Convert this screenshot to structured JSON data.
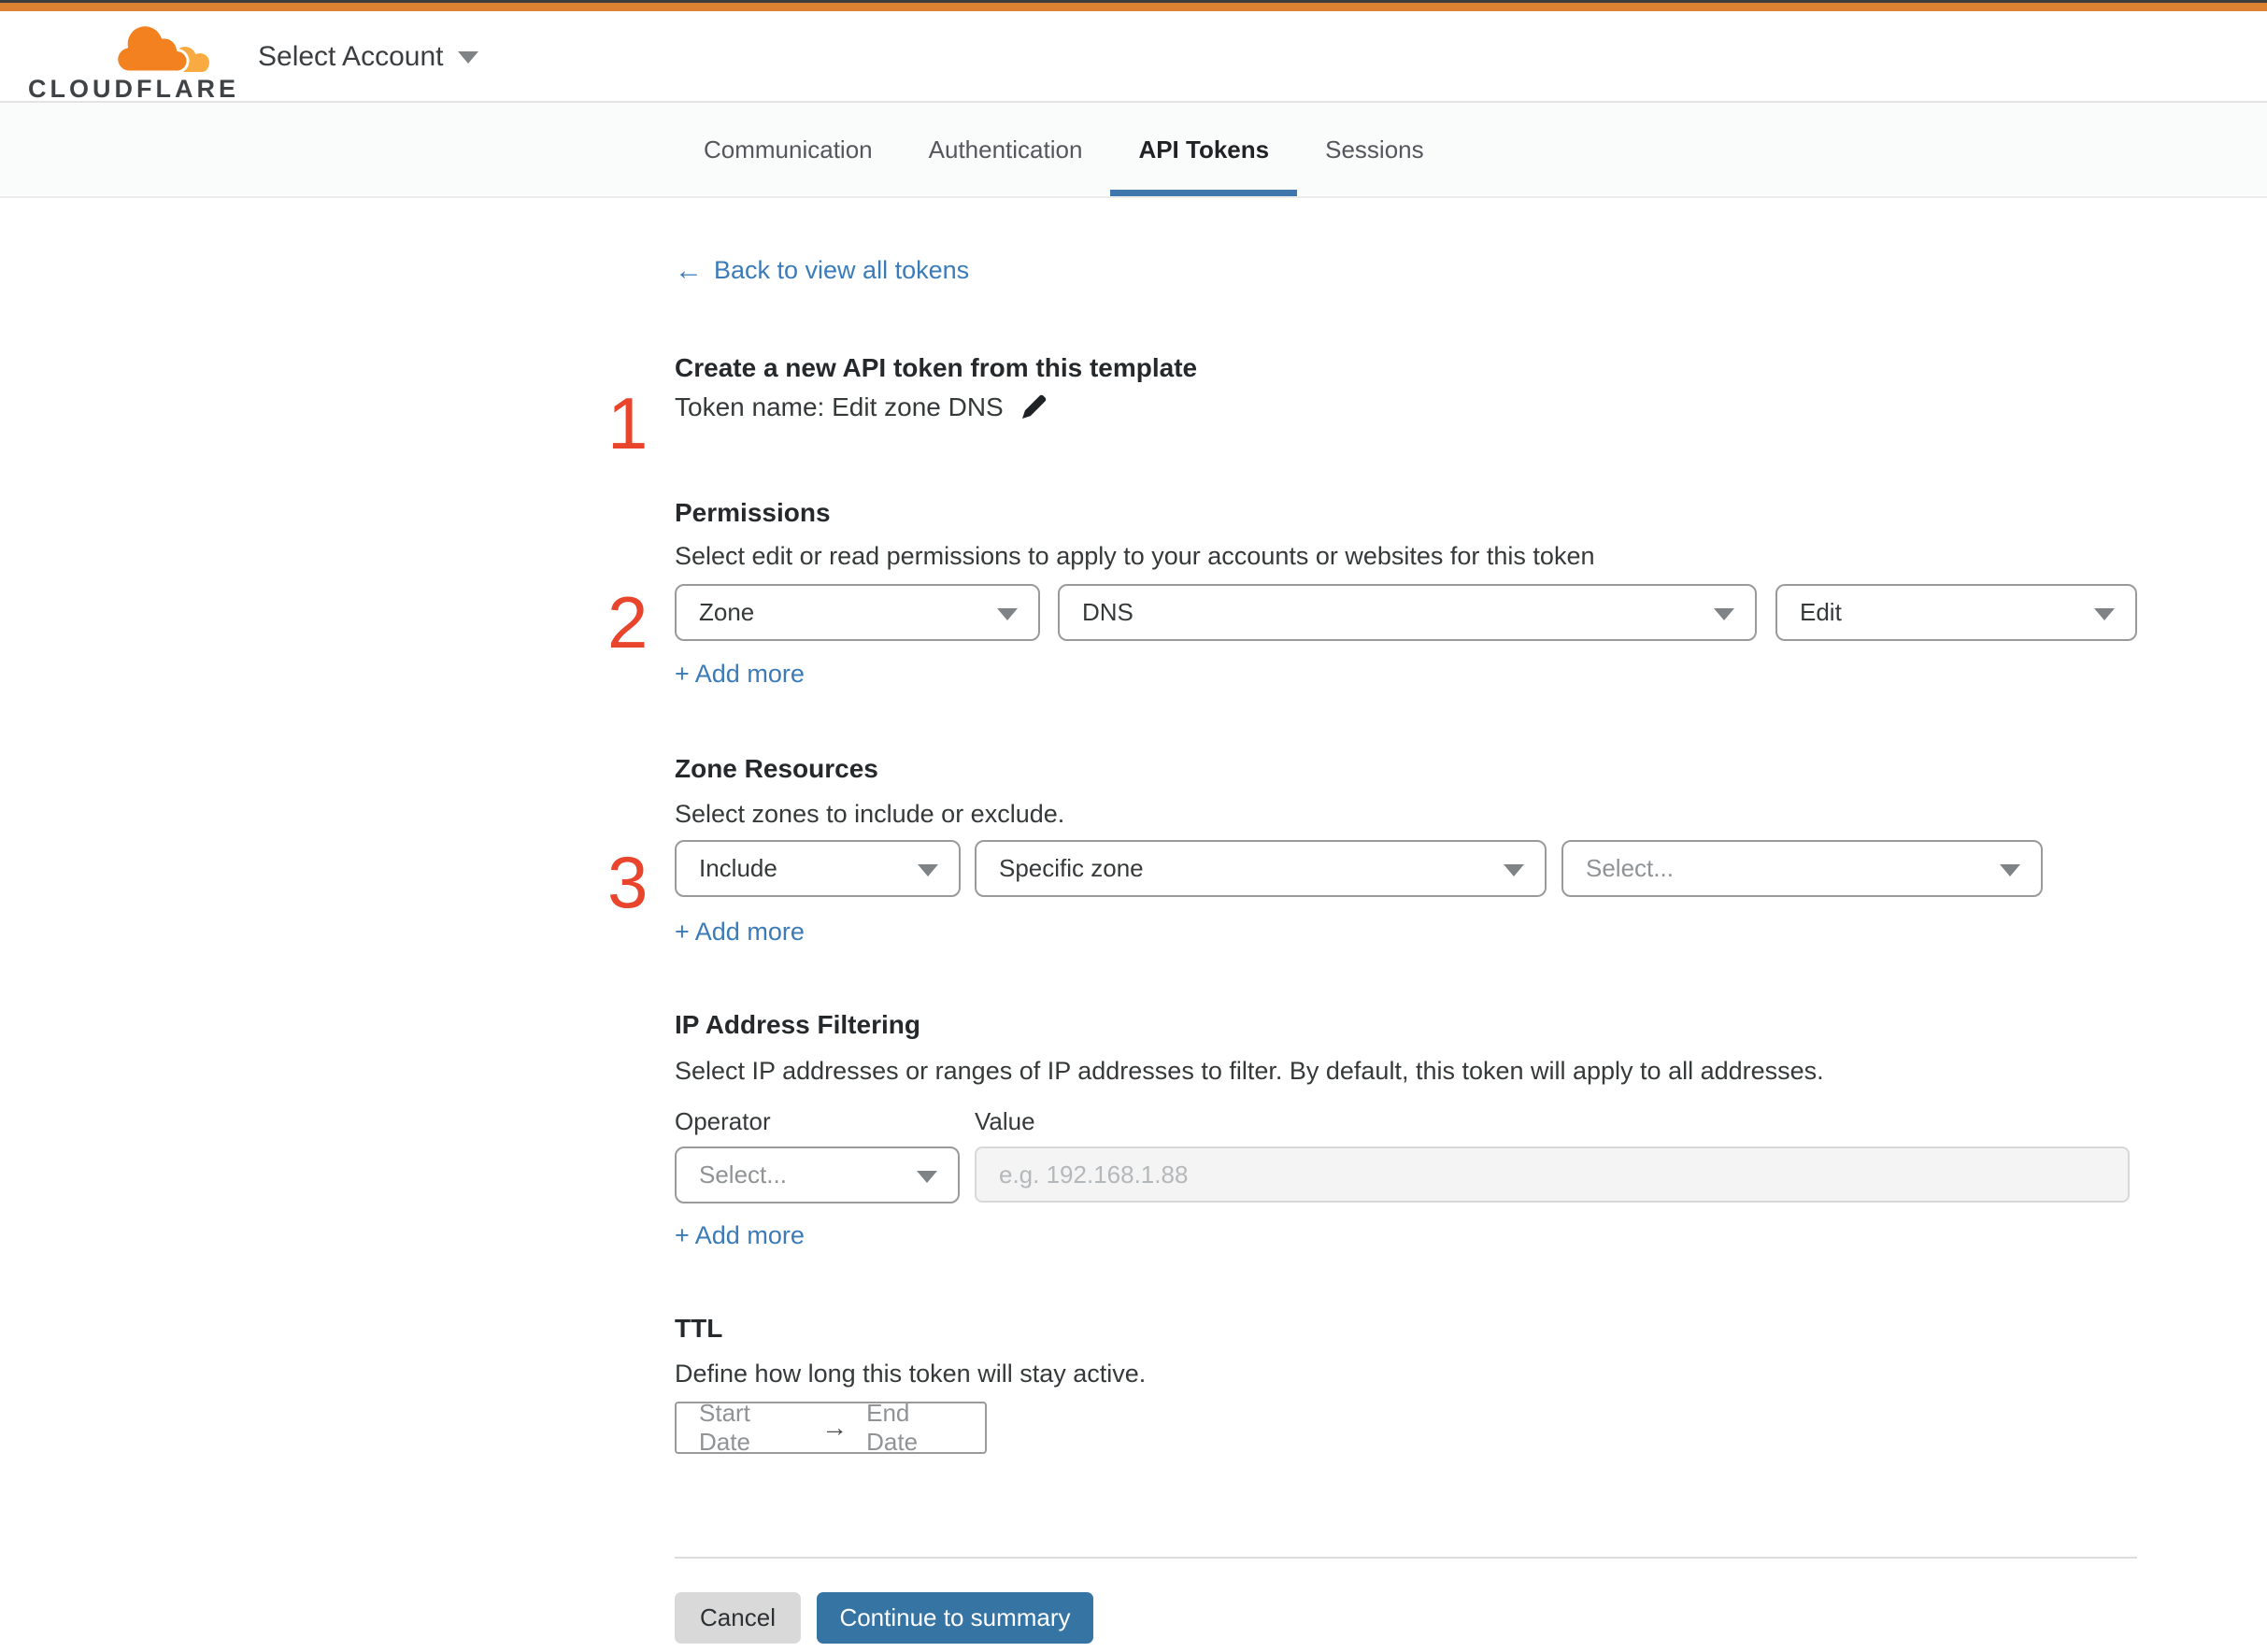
{
  "colors": {
    "topbar_dark": "#3e3e3e",
    "accent_orange": "#dd8230",
    "logo_orange": "#f48120",
    "logo_light_orange": "#f9ab41",
    "step_number_red": "#e8452c",
    "link_blue": "#3a7bb8",
    "tab_underline_blue": "#3f76ab",
    "button_blue": "#3674a4"
  },
  "header": {
    "logo_text": "CLOUDFLARE",
    "account_selector_label": "Select Account"
  },
  "tabs": [
    {
      "label": "Communication",
      "active": false
    },
    {
      "label": "Authentication",
      "active": false
    },
    {
      "label": "API Tokens",
      "active": true
    },
    {
      "label": "Sessions",
      "active": false
    }
  ],
  "back_link": {
    "arrow": "←",
    "label": "Back to view all tokens"
  },
  "token_template": {
    "step_number": "1",
    "heading": "Create a new API token from this template",
    "token_name_line": "Token name: Edit zone DNS"
  },
  "permissions": {
    "step_number": "2",
    "heading": "Permissions",
    "subtitle": "Select edit or read permissions to apply to your accounts or websites for this token",
    "scope_value": "Zone",
    "resource_value": "DNS",
    "access_value": "Edit",
    "add_more_label": "+ Add more"
  },
  "zone_resources": {
    "step_number": "3",
    "heading": "Zone Resources",
    "subtitle": "Select zones to include or exclude.",
    "mode_value": "Include",
    "scope_value": "Specific zone",
    "zone_placeholder": "Select...",
    "add_more_label": "+ Add more"
  },
  "ip_filtering": {
    "heading": "IP Address Filtering",
    "subtitle": "Select IP addresses or ranges of IP addresses to filter. By default, this token will apply to all addresses.",
    "operator_label": "Operator",
    "value_label": "Value",
    "operator_placeholder": "Select...",
    "value_placeholder": "e.g. 192.168.1.88",
    "add_more_label": "+ Add more"
  },
  "ttl": {
    "heading": "TTL",
    "subtitle": "Define how long this token will stay active.",
    "start_date_placeholder": "Start Date",
    "arrow": "→",
    "end_date_placeholder": "End Date"
  },
  "footer": {
    "cancel_label": "Cancel",
    "continue_label": "Continue to summary"
  }
}
